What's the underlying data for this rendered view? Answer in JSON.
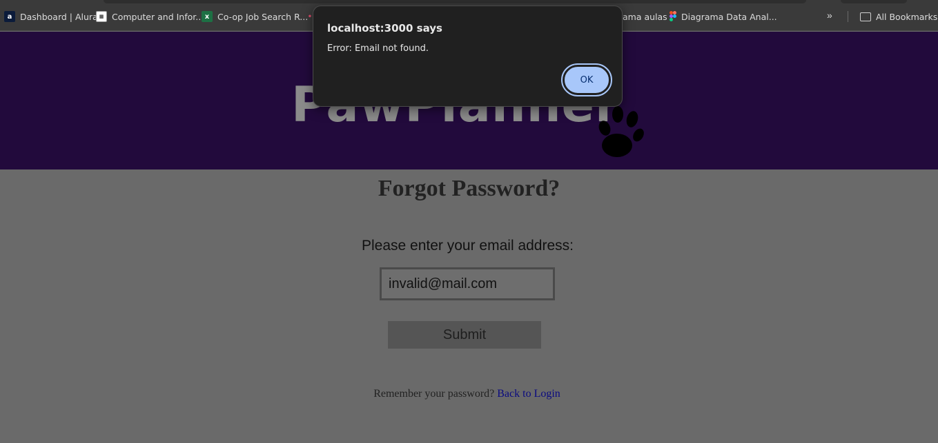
{
  "bookmarks": {
    "items": [
      {
        "label": "Dashboard | Alura",
        "icon": "alura-icon"
      },
      {
        "label": "Computer and Infor...",
        "icon": "cs-icon"
      },
      {
        "label": "Co-op Job Search R...",
        "icon": "excel-icon"
      },
      {
        "label": "ama aulas",
        "icon": "bookmark-icon"
      },
      {
        "label": "Diagrama Data Anal...",
        "icon": "figma-icon"
      }
    ],
    "overflow_icon": "double-chevron-icon",
    "all_bookmarks": "All Bookmarks"
  },
  "header": {
    "logo_text": "PawPlanner",
    "bg_color": "#220a3c"
  },
  "form": {
    "title": "Forgot Password?",
    "prompt": "Please enter your email address:",
    "email_value": "invalid@mail.com",
    "submit_label": "Submit",
    "remember_text": "Remember your password?",
    "back_link": "Back to Login"
  },
  "dialog": {
    "title": "localhost:3000 says",
    "message": "Error: Email not found.",
    "ok_label": "OK",
    "accent": "#a8c7fa"
  }
}
